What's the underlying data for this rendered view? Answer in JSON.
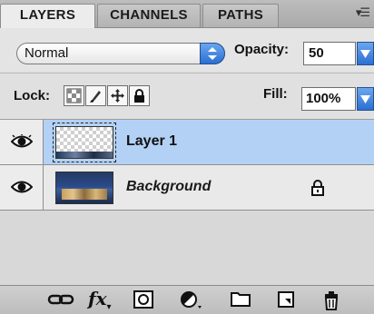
{
  "tabs": [
    {
      "label": "LAYERS",
      "active": true
    },
    {
      "label": "CHANNELS",
      "active": false
    },
    {
      "label": "PATHS",
      "active": false
    }
  ],
  "tab_menu_icon": "panel-menu-icon",
  "blend": {
    "value": "Normal"
  },
  "opacity": {
    "label": "Opacity:",
    "value": "50"
  },
  "lock": {
    "label": "Lock:",
    "buttons": [
      "lock-transparent-pixels-icon",
      "lock-image-pixels-icon",
      "lock-position-icon",
      "lock-all-icon"
    ]
  },
  "fill": {
    "label": "Fill:",
    "value": "100%"
  },
  "layers": [
    {
      "name": "Layer 1",
      "visible": true,
      "selected": true,
      "locked": false,
      "italic": false
    },
    {
      "name": "Background",
      "visible": true,
      "selected": false,
      "locked": true,
      "italic": true
    }
  ],
  "footer_icons": [
    "link-layers-icon",
    "layer-style-fx-icon",
    "add-layer-mask-icon",
    "adjustment-layer-icon",
    "new-group-folder-icon",
    "new-layer-icon",
    "delete-layer-trash-icon"
  ],
  "fx_label": "fx",
  "colors": {
    "selection": "#b3d1f5",
    "accent_blue": "#2a6fd3",
    "panel_bg": "#dcdcdc"
  }
}
